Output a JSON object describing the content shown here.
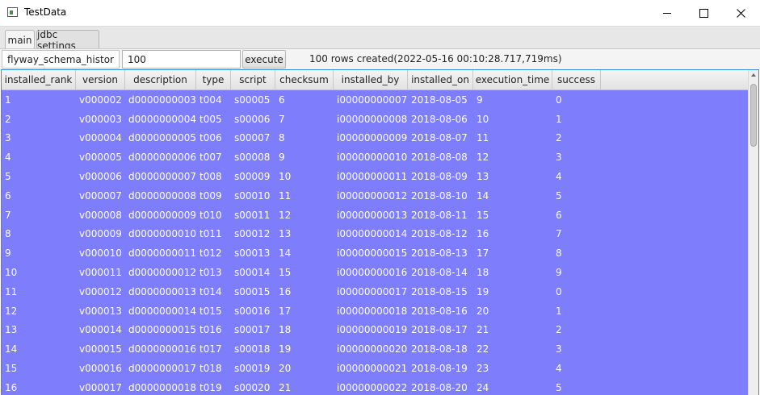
{
  "window": {
    "title": "TestData"
  },
  "tabs": [
    {
      "label": "main"
    },
    {
      "label": "jdbc settings"
    }
  ],
  "toolbar": {
    "table_name": "flyway_schema_history",
    "row_count": "100",
    "execute_label": "execute",
    "status": "100 rows created(2022-05-16 00:10:28.717,719ms)"
  },
  "table": {
    "columns": [
      "installed_rank",
      "version",
      "description",
      "type",
      "script",
      "checksum",
      "installed_by",
      "installed_on",
      "execution_time",
      "success"
    ],
    "rows": [
      [
        "1",
        "v000002",
        "d0000000003",
        "t004",
        "s00005",
        "6",
        "i00000000007",
        "2018-08-05",
        "9",
        "0"
      ],
      [
        "2",
        "v000003",
        "d0000000004",
        "t005",
        "s00006",
        "7",
        "i00000000008",
        "2018-08-06",
        "10",
        "1"
      ],
      [
        "3",
        "v000004",
        "d0000000005",
        "t006",
        "s00007",
        "8",
        "i00000000009",
        "2018-08-07",
        "11",
        "2"
      ],
      [
        "4",
        "v000005",
        "d0000000006",
        "t007",
        "s00008",
        "9",
        "i00000000010",
        "2018-08-08",
        "12",
        "3"
      ],
      [
        "5",
        "v000006",
        "d0000000007",
        "t008",
        "s00009",
        "10",
        "i00000000011",
        "2018-08-09",
        "13",
        "4"
      ],
      [
        "6",
        "v000007",
        "d0000000008",
        "t009",
        "s00010",
        "11",
        "i00000000012",
        "2018-08-10",
        "14",
        "5"
      ],
      [
        "7",
        "v000008",
        "d0000000009",
        "t010",
        "s00011",
        "12",
        "i00000000013",
        "2018-08-11",
        "15",
        "6"
      ],
      [
        "8",
        "v000009",
        "d0000000010",
        "t011",
        "s00012",
        "13",
        "i00000000014",
        "2018-08-12",
        "16",
        "7"
      ],
      [
        "9",
        "v000010",
        "d0000000011",
        "t012",
        "s00013",
        "14",
        "i00000000015",
        "2018-08-13",
        "17",
        "8"
      ],
      [
        "10",
        "v000011",
        "d0000000012",
        "t013",
        "s00014",
        "15",
        "i00000000016",
        "2018-08-14",
        "18",
        "9"
      ],
      [
        "11",
        "v000012",
        "d0000000013",
        "t014",
        "s00015",
        "16",
        "i00000000017",
        "2018-08-15",
        "19",
        "0"
      ],
      [
        "12",
        "v000013",
        "d0000000014",
        "t015",
        "s00016",
        "17",
        "i00000000018",
        "2018-08-16",
        "20",
        "1"
      ],
      [
        "13",
        "v000014",
        "d0000000015",
        "t016",
        "s00017",
        "18",
        "i00000000019",
        "2018-08-17",
        "21",
        "2"
      ],
      [
        "14",
        "v000015",
        "d0000000016",
        "t017",
        "s00018",
        "19",
        "i00000000020",
        "2018-08-18",
        "22",
        "3"
      ],
      [
        "15",
        "v000016",
        "d0000000017",
        "t018",
        "s00019",
        "20",
        "i00000000021",
        "2018-08-19",
        "23",
        "4"
      ],
      [
        "16",
        "v000017",
        "d0000000018",
        "t019",
        "s00020",
        "21",
        "i00000000022",
        "2018-08-20",
        "24",
        "5"
      ]
    ]
  },
  "colors": {
    "row_background": "#7e7efd",
    "row_text": "#ffffff",
    "focus_border": "#2f8fd6"
  },
  "icons": {
    "app": "app-window-icon",
    "minimize": "minimize-icon",
    "maximize": "maximize-icon",
    "close": "close-icon",
    "scroll_up": "scroll-up-arrow-icon"
  }
}
